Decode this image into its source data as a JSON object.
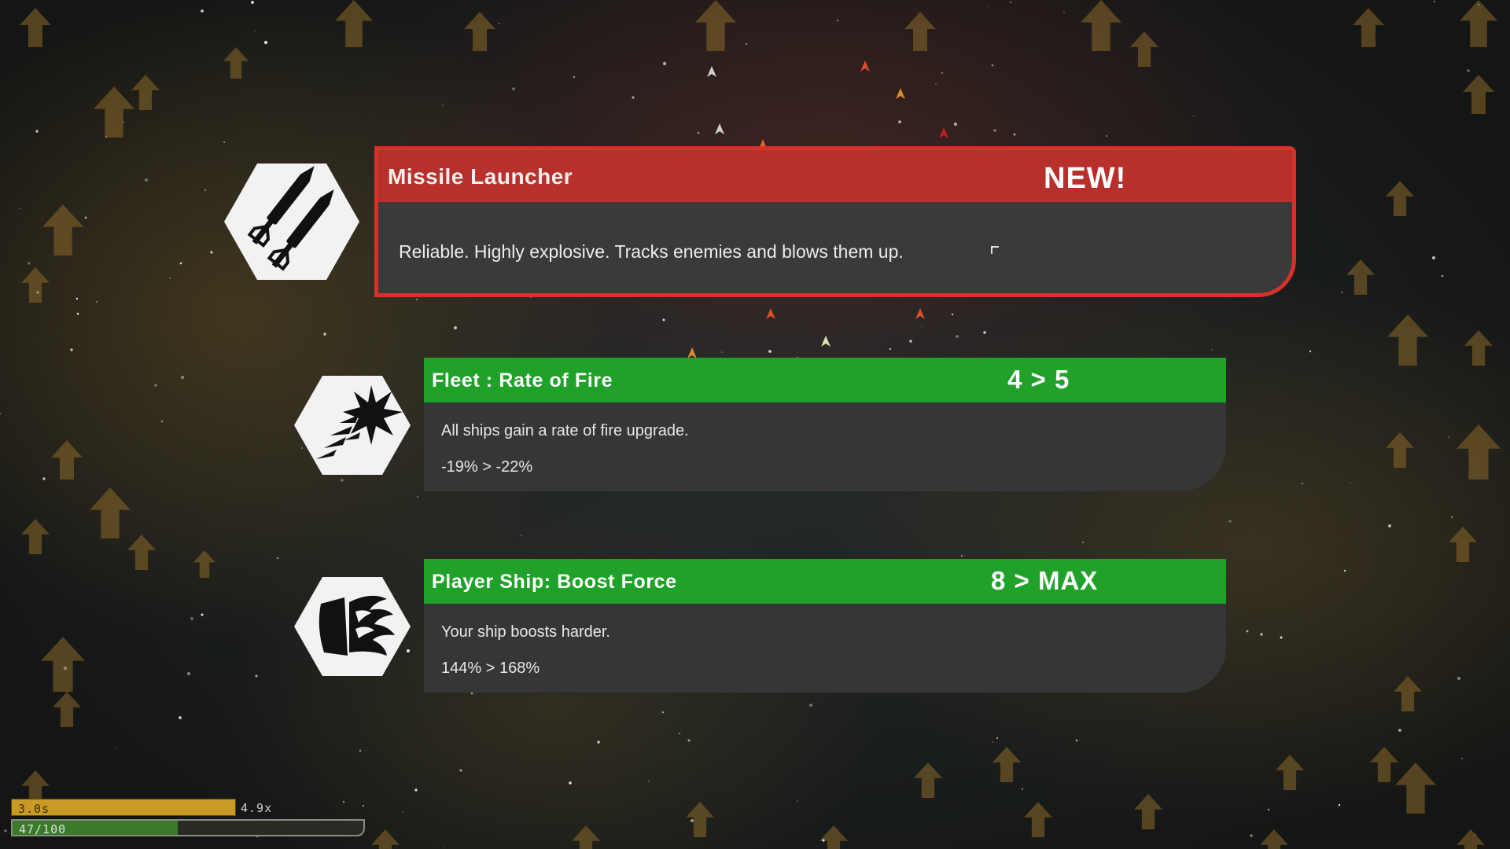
{
  "upgrades": [
    {
      "id": "missile",
      "title": "Missile Launcher",
      "tag": "NEW!",
      "description": "Reliable. Highly explosive. Tracks enemies and blows them up.",
      "icon": "missile-icon",
      "header_color": "#b8302b",
      "border_color": "#d7312a"
    },
    {
      "id": "fleet",
      "title": "Fleet : Rate of Fire",
      "level": "4 > 5",
      "description": "All ships gain a rate of fire upgrade.",
      "stat": "-19% > -22%",
      "icon": "rate-of-fire-icon",
      "header_color": "#1fa12a"
    },
    {
      "id": "boost",
      "title": "Player Ship: Boost Force",
      "level": "8 > MAX",
      "description": "Your ship boosts harder.",
      "stat": "144% > 168%",
      "icon": "boost-thruster-icon",
      "header_color": "#1fa12a"
    }
  ],
  "hud": {
    "timer": "3.0s",
    "multiplier": "4.9x",
    "xp": "47/100",
    "xp_fraction": 0.47,
    "timer_color": "#c99a26",
    "xp_color": "#3a7a2a"
  }
}
